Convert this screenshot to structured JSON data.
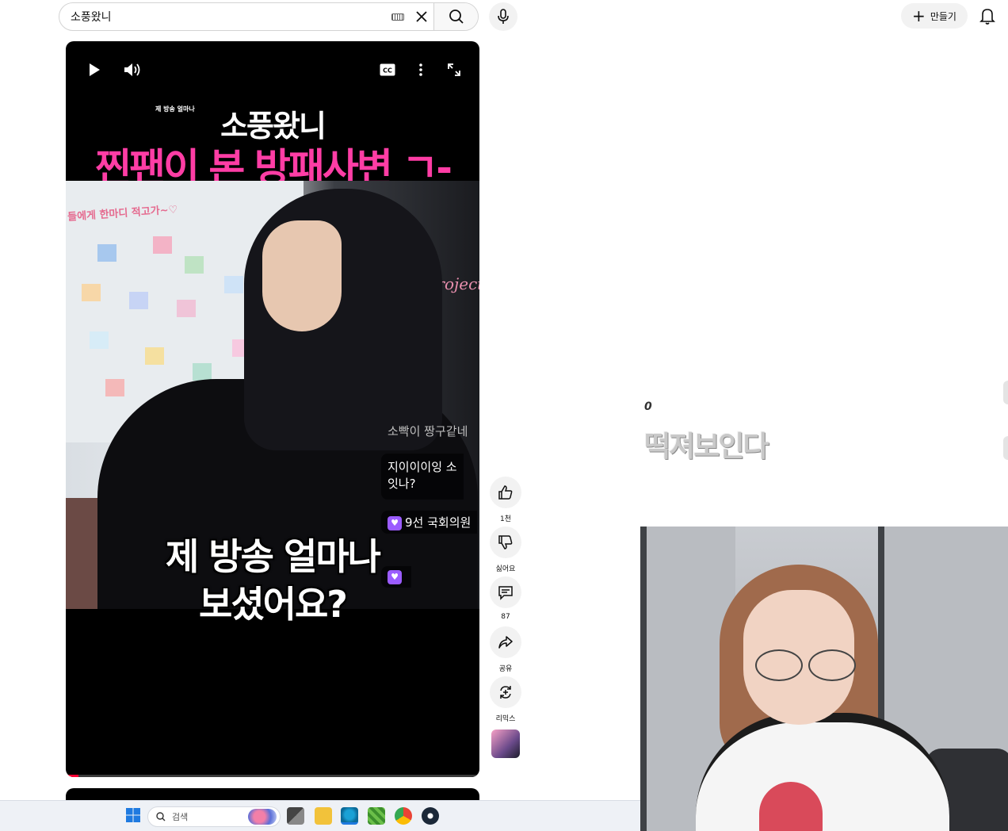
{
  "header": {
    "search_value": "소풍왔니",
    "create_label": "만들기"
  },
  "short": {
    "headline_small": "제 방송 얼마나",
    "headline_title": "소풍왔니",
    "headline_pink": "찐팬이 본 방패사변 ㄱ-",
    "board_text": "들에게 한마디 적고가~♡",
    "wall_text": "Project",
    "chat": [
      "소빡이 짱구같네",
      "지이이이잉 소",
      "잇나?",
      "9선 국회의원",
      ""
    ],
    "subtitle_line1": "제 방송 얼마나",
    "subtitle_line2": "보셨어요?",
    "progress": 0.03
  },
  "actions": {
    "like_count": "1천",
    "dislike_label": "싫어요",
    "comment_count": "87",
    "share_label": "공유",
    "remix_label": "리믹스"
  },
  "overlay": {
    "small_text": "0",
    "big_text": "떡져보인다"
  },
  "taskbar": {
    "search_placeholder": "검색"
  },
  "colors": {
    "pink_headline": "#ff3da5",
    "progress_red": "#ff0033",
    "chat_badge": "#9b5cff"
  }
}
